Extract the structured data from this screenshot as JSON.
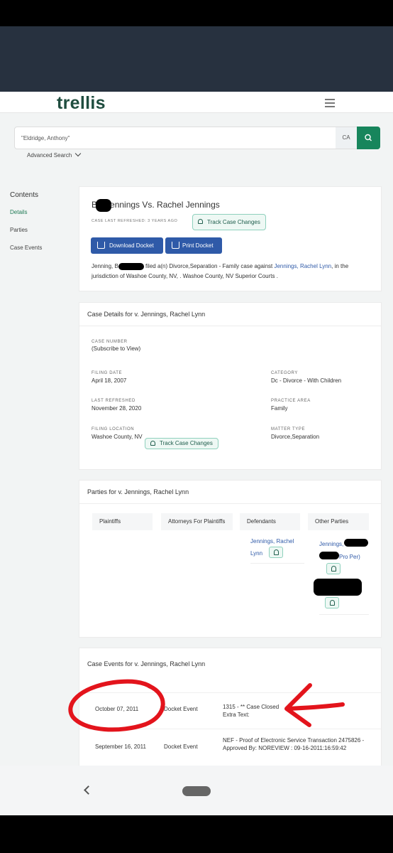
{
  "brand": {
    "logo": "trellis"
  },
  "search": {
    "value": "\"Eldridge, Anthony\"",
    "state": "CA",
    "advanced_label": "Advanced Search"
  },
  "sidebar": {
    "title": "Contents",
    "items": [
      {
        "label": "Details",
        "active": true
      },
      {
        "label": "Parties",
        "active": false
      },
      {
        "label": "Case Events",
        "active": false
      }
    ]
  },
  "case": {
    "title_suffix": "ennings Vs. Rachel Jennings",
    "title_prefix": "B",
    "refreshed": "CASE LAST REFRESHED: 3 YEARS AGO",
    "track_label": "Track Case Changes",
    "download_label": "Download Docket",
    "print_label": "Print Docket",
    "desc_start": "Jenning, B",
    "desc_mid": "filed a(n) Divorce,Separation - Family case against ",
    "desc_link": "Jennings, Rachel Lynn",
    "desc_end": ", in the jurisdiction of Washoe County, NV, . Washoe County, NV Superior Courts ."
  },
  "details": {
    "heading": "Case Details for v. Jennings, Rachel Lynn",
    "case_number_label": "CASE NUMBER",
    "case_number_link": "(Subscribe to View)",
    "track_label": "Track Case Changes",
    "filing_date_label": "FILING DATE",
    "filing_date": "April 18, 2007",
    "category_label": "CATEGORY",
    "category": "Dc - Divorce - With Children",
    "last_refreshed_label": "LAST REFRESHED",
    "last_refreshed": "November 28, 2020",
    "practice_area_label": "PRACTICE AREA",
    "practice_area": "Family",
    "filing_location_label": "FILING LOCATION",
    "filing_location": "Washoe County, NV",
    "matter_type_label": "MATTER TYPE",
    "matter_type": "Divorce,Separation"
  },
  "parties": {
    "heading": "Parties for v. Jennings, Rachel Lynn",
    "columns": [
      "Plaintiffs",
      "Attorneys For Plaintiffs",
      "Defendants",
      "Other Parties"
    ],
    "defendant_line1": "Jennings, Rachel",
    "defendant_line2": "Lynn",
    "other_party_line1": "Jennings,",
    "other_party_line2": "Pro Per)"
  },
  "events": {
    "heading": "Case Events for v. Jennings, Rachel Lynn",
    "rows": [
      {
        "date": "October 07, 2011",
        "type": "Docket Event",
        "desc": "1315 - ** Case Closed\nExtra Text:"
      },
      {
        "date": "September 16, 2011",
        "type": "Docket Event",
        "desc": "NEF - Proof of Electronic Service Transaction 2475826 - Approved By: NOREVIEW : 09-16-2011:16:59:42"
      }
    ]
  },
  "colors": {
    "brand_green": "#1f4d3f",
    "accent_green": "#17855c",
    "button_blue": "#2f5aa8",
    "link_blue": "#2f5aa8",
    "annotation_red": "#e3141c"
  }
}
